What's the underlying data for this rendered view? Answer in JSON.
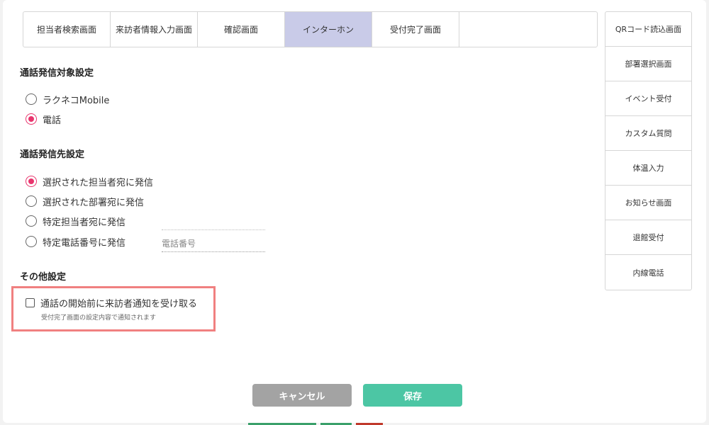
{
  "tabs": [
    {
      "label": "担当者検索画面",
      "active": false
    },
    {
      "label": "来訪者情報入力画面",
      "active": false
    },
    {
      "label": "確認画面",
      "active": false
    },
    {
      "label": "インターホン",
      "active": true
    },
    {
      "label": "受付完了画面",
      "active": false
    },
    {
      "label": "",
      "active": false
    }
  ],
  "side_tabs": [
    {
      "label": "QRコード読込画面"
    },
    {
      "label": "部署選択画面"
    },
    {
      "label": "イベント受付"
    },
    {
      "label": "カスタム質問"
    },
    {
      "label": "体温入力"
    },
    {
      "label": "お知らせ画面"
    },
    {
      "label": "退館受付"
    },
    {
      "label": "内線電話"
    }
  ],
  "call_target": {
    "title": "通話発信対象設定",
    "options": [
      {
        "label": "ラクネコMobile",
        "checked": false
      },
      {
        "label": "電話",
        "checked": true
      }
    ]
  },
  "call_destination": {
    "title": "通話発信先設定",
    "options": [
      {
        "label": "選択された担当者宛に発信",
        "checked": true
      },
      {
        "label": "選択された部署宛に発信",
        "checked": false
      },
      {
        "label": "特定担当者宛に発信",
        "checked": false
      },
      {
        "label": "特定電話番号に発信",
        "checked": false
      }
    ],
    "phone_placeholder": "電話番号"
  },
  "other": {
    "title": "その他設定",
    "checkbox_label": "通話の開始前に来訪者通知を受け取る",
    "checkbox_checked": false,
    "note": "受付完了画面の設定内容で通知されます"
  },
  "buttons": {
    "cancel": "キャンセル",
    "save": "保存"
  },
  "colors": {
    "accent_radio": "#e8356d",
    "active_tab": "#c9cbe8",
    "save_button": "#4cc6a4",
    "cancel_button": "#a3a3a3",
    "highlight_border": "#f08080"
  }
}
